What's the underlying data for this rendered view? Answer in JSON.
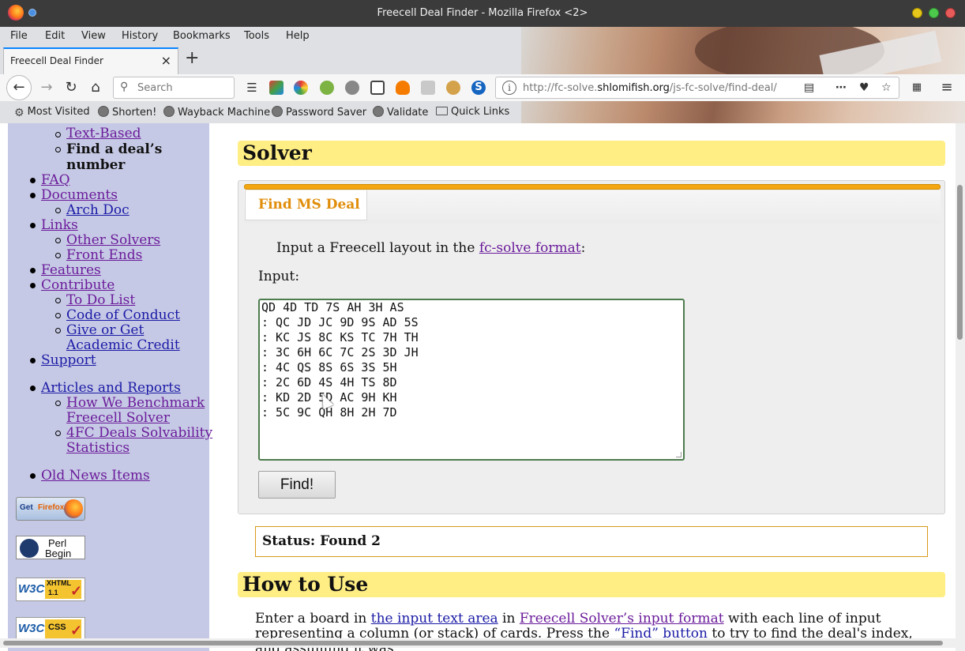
{
  "window": {
    "title": "Freecell Deal Finder - Mozilla Firefox <2>"
  },
  "menu": [
    "File",
    "Edit",
    "View",
    "History",
    "Bookmarks",
    "Tools",
    "Help"
  ],
  "tab": {
    "label": "Freecell Deal Finder",
    "close": "×"
  },
  "newtab": "+",
  "search": {
    "placeholder": "Search"
  },
  "url": {
    "prefix": "http://fc-solve.",
    "domain": "shlomifish.org",
    "path": "/js-fc-solve/find-deal/"
  },
  "bookmarks": [
    "Most Visited",
    "Shorten!",
    "Wayback Machine",
    "Password Saver",
    "Validate",
    "Quick Links"
  ],
  "sidebar": {
    "items": [
      {
        "label": "Text-Based"
      },
      {
        "label": "Find a deal’s",
        "label2": "number"
      },
      {
        "label": "FAQ"
      },
      {
        "label": "Documents"
      },
      {
        "label": "Arch Doc"
      },
      {
        "label": "Links"
      },
      {
        "label": "Other Solvers"
      },
      {
        "label": "Front Ends"
      },
      {
        "label": "Features"
      },
      {
        "label": "Contribute"
      },
      {
        "label": "To Do List"
      },
      {
        "label": "Code of Conduct"
      },
      {
        "label": "Give or Get",
        "label2": "Academic Credit"
      },
      {
        "label": "Support"
      },
      {
        "label": "Articles and Reports"
      },
      {
        "label": "How We Benchmark",
        "label2": "Freecell Solver"
      },
      {
        "label": "4FC Deals Solvability",
        "label2": "Statistics"
      },
      {
        "label": "Old News Items"
      }
    ],
    "badges": {
      "getfirefox": {
        "a": "Get",
        "b": "Firefox"
      },
      "perl": {
        "a": "Perl",
        "b": "Begin"
      },
      "xhtml": {
        "a": "W3C",
        "b": "XHTML",
        "c": "1.1"
      },
      "css": {
        "a": "W3C",
        "b": "CSS"
      }
    }
  },
  "main": {
    "solver_heading": "Solver",
    "tab_label": "Find MS Deal",
    "intro_before": "Input a Freecell layout in the ",
    "intro_link": "fc-solve format",
    "intro_after": ":",
    "input_label": "Input:",
    "board_lines": [
      "QD 4D TD 7S AH 3H AS",
      ": QC JD JC 9D 9S AD 5S",
      ": KC JS 8C KS TC 7H TH",
      ": 3C 6H 6C 7C 2S 3D JH",
      ": 4C QS 8S 6S 3S 5H",
      ": 2C 6D 4S 4H TS 8D",
      ": KD 2D 5D AC 9H KH",
      ": 5C 9C QH 8H 2H 7D"
    ],
    "find_button": "Find!",
    "status": "Status: Found 2",
    "howto_heading": "How to Use",
    "para": {
      "t1": "Enter a board in ",
      "l1": "the input text area",
      "t2": " in ",
      "l2": "Freecell Solver’s input format",
      "t3": " with each line of input representing a column (or stack) of cards. Press the ",
      "l3": "“Find” button",
      "t4": " to try to find the deal's index, and assuming it was"
    }
  },
  "colors": {
    "heading_bg": "#ffee84",
    "sidebar_bg": "#c6c9e5",
    "tab_accent": "#f3a60f",
    "visited_link": "#6a1b9a",
    "link": "#1a1aa6"
  }
}
